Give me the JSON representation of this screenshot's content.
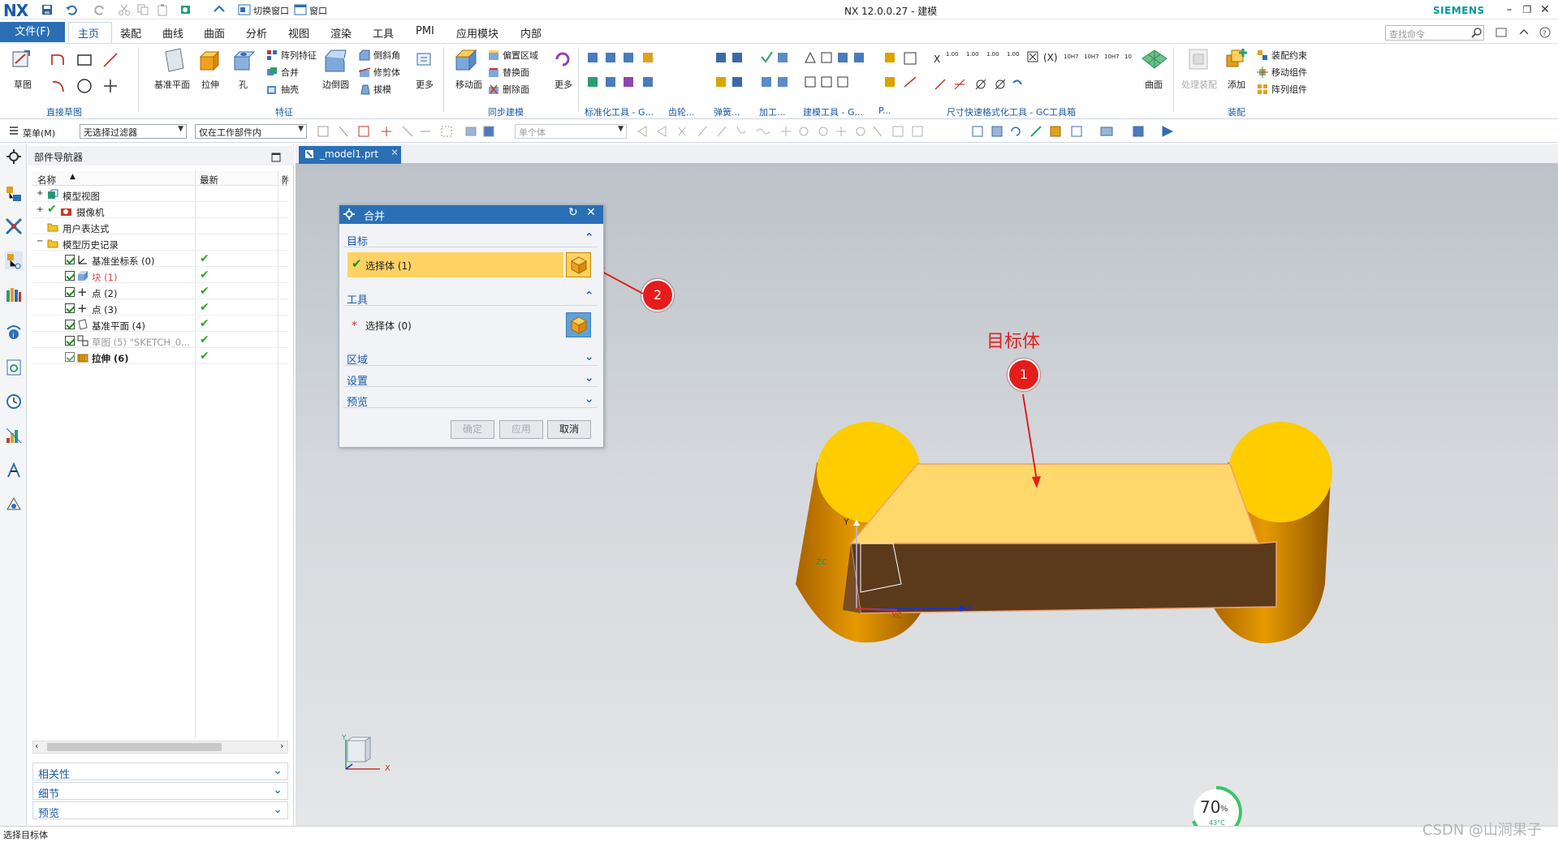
{
  "app": {
    "logo": "NX",
    "window_title": "NX 12.0.0.27 - 建模",
    "brand": "SIEMENS",
    "quick_access": {
      "switch_window": "切换窗口",
      "window": "窗口"
    }
  },
  "menu_tabs": {
    "file": "文件(F)",
    "items": [
      "主页",
      "装配",
      "曲线",
      "曲面",
      "分析",
      "视图",
      "渲染",
      "工具",
      "PMI",
      "应用模块",
      "内部"
    ],
    "active": "主页"
  },
  "search": {
    "placeholder": "查找命令"
  },
  "ribbon": {
    "sketch": "草图",
    "group_direct_sketch": "直接草图",
    "datum_plane": "基准平面",
    "extrude": "拉伸",
    "hole": "孔",
    "pattern_feature": "阵列特征",
    "unite": "合并",
    "shell": "抽壳",
    "edge_blend": "边倒圆",
    "chamfer": "倒斜角",
    "trim_body": "修剪体",
    "draft": "拔模",
    "more1": "更多",
    "group_feature": "特征",
    "move_face": "移动面",
    "offset_region": "偏置区域",
    "replace_face": "替换面",
    "delete_face": "删除面",
    "more2": "更多",
    "group_sync": "同步建模",
    "group_std": "标准化工具 - G...",
    "group_gear": "齿轮...",
    "group_spring": "弹簧...",
    "group_machining": "加工...",
    "group_modeling_tools": "建模工具 - G...",
    "group_p": "P...",
    "group_dim": "尺寸快速格式化工具 - GC工具箱",
    "surface": "曲面",
    "process_assembly": "处理装配",
    "add": "添加",
    "assembly_constraint": "装配约束",
    "move_component": "移动组件",
    "pattern_component": "阵列组件",
    "group_assembly": "装配",
    "dim_labels": [
      "1.00",
      "1.00",
      "1.00",
      "1.00",
      "10H7",
      "10H7",
      "10H7",
      "10"
    ]
  },
  "toolbar2": {
    "menu": "菜单(M)",
    "filter": "无选择过滤器",
    "scope": "仅在工作部件内",
    "body": "单个体"
  },
  "navigator": {
    "title": "部件导航器",
    "col_name": "名称",
    "col_latest": "最新",
    "col_extra": "附",
    "items": [
      {
        "label": "模型视图"
      },
      {
        "label": "摄像机"
      },
      {
        "label": "用户表达式"
      },
      {
        "label": "模型历史记录"
      },
      {
        "label": "基准坐标系 (0)"
      },
      {
        "label": "块 (1)"
      },
      {
        "label": "点 (2)"
      },
      {
        "label": "点 (3)"
      },
      {
        "label": "基准平面 (4)"
      },
      {
        "label": "草图 (5) \"SKETCH_0..."
      },
      {
        "label": "拉伸 (6)"
      }
    ],
    "panels": [
      "相关性",
      "细节",
      "预览"
    ]
  },
  "doc_tab": {
    "name": "_model1.prt"
  },
  "dialog": {
    "title": "合并",
    "target_section": "目标",
    "target_select": "选择体 (1)",
    "tool_section": "工具",
    "tool_select": "选择体 (0)",
    "region": "区域",
    "settings": "设置",
    "preview": "预览",
    "ok": "确定",
    "apply": "应用",
    "cancel": "取消"
  },
  "annotations": {
    "target_body": "目标体",
    "marker1": "1",
    "marker2": "2"
  },
  "axis_labels": {
    "y": "Y",
    "x": "X",
    "xc": "XC",
    "zc": "ZC",
    "yc": "YC"
  },
  "performance": {
    "percent": "70",
    "unit": "%",
    "temp": "43°C"
  },
  "status": {
    "text": "选择目标体"
  },
  "watermark": "CSDN @山涧果子",
  "colors": {
    "accent": "#2a6fb5",
    "selection_bar": "#ffd264",
    "annotation_red": "#e02020",
    "body_yellow": "#ffcc00",
    "body_orange": "#d98a00"
  }
}
